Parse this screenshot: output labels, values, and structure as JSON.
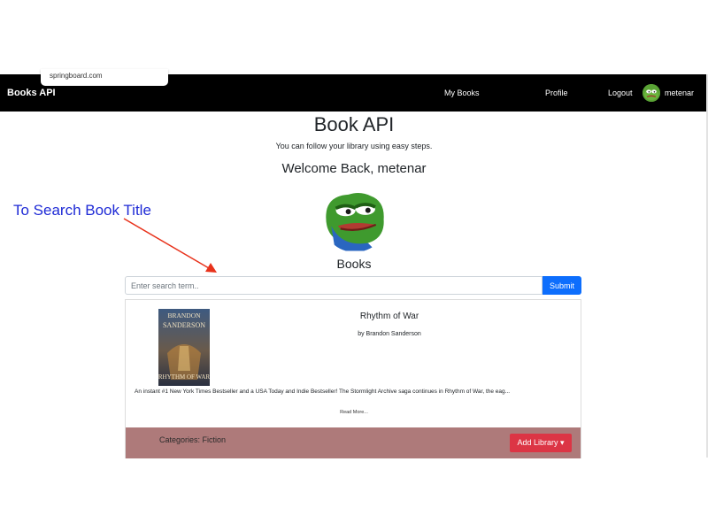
{
  "browser": {
    "url_tooltip": "springboard.com"
  },
  "navbar": {
    "brand": "Books API",
    "links": [
      "My Books",
      "Profile",
      "Logout"
    ],
    "username": "metenar"
  },
  "hero": {
    "title": "Book API",
    "subtitle": "You can follow your library using easy steps.",
    "welcome": "Welcome Back, metenar"
  },
  "books": {
    "heading": "Books",
    "search": {
      "placeholder": "Enter search term..",
      "value": "",
      "submit_label": "Submit"
    }
  },
  "annotation": {
    "text": "To Search Book Title",
    "color": "#1f2bd6",
    "arrow_color": "#e8321b"
  },
  "book": {
    "cover_author": "BRANDON SANDERSON",
    "cover_title": "RHYTHM OF WAR",
    "title": "Rhythm of War",
    "author": "by Brandon Sanderson",
    "description": "An instant #1 New York Times Bestseller and a USA Today and Indie Bestseller! The Stormlight Archive saga continues in Rhythm of War, the eag...",
    "read_more": "Read More...",
    "categories": "Categories: Fiction",
    "add_library_label": "Add Library",
    "add_library_caret": "▾"
  },
  "colors": {
    "navbar_bg": "#000000",
    "submit_bg": "#0d6efd",
    "card_footer_bg": "#ae7a7a",
    "add_library_bg": "#dc3545"
  },
  "icons": {
    "avatar": "frog-avatar-icon",
    "dropdown": "caret-down-icon"
  }
}
